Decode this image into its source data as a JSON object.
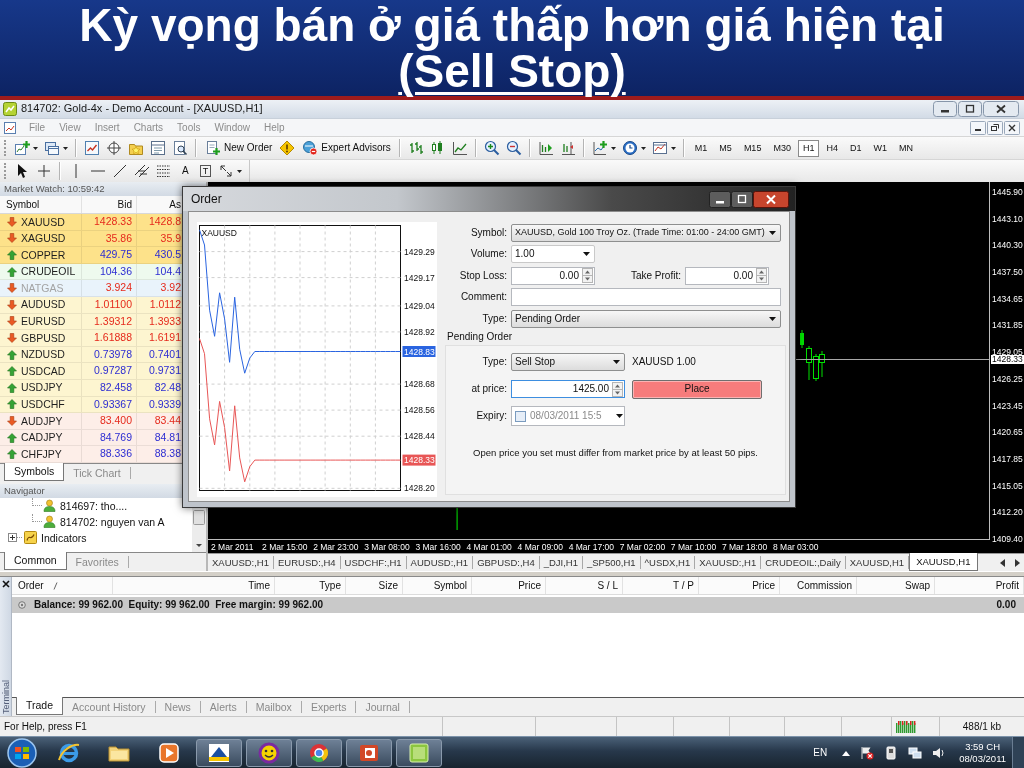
{
  "slide": {
    "title": "Kỳ vọng bán ở giá thấp hơn giá hiện tại",
    "subtitle": "(Sell Stop)"
  },
  "window": {
    "title": "814702: Gold-4x - Demo Account - [XAUUSD,H1]"
  },
  "menu": [
    {
      "label": "File",
      "disabled": true
    },
    {
      "label": "View",
      "disabled": true
    },
    {
      "label": "Insert",
      "disabled": true
    },
    {
      "label": "Charts",
      "disabled": true
    },
    {
      "label": "Tools",
      "disabled": true
    },
    {
      "label": "Window",
      "disabled": true
    },
    {
      "label": "Help",
      "disabled": true
    }
  ],
  "toolbar": {
    "new_order": "New Order",
    "expert_advisors": "Expert Advisors",
    "timeframes": [
      {
        "label": "M1",
        "selected": false
      },
      {
        "label": "M5",
        "selected": false
      },
      {
        "label": "M15",
        "selected": false
      },
      {
        "label": "M30",
        "selected": false
      },
      {
        "label": "H1",
        "selected": true
      },
      {
        "label": "H4",
        "selected": false
      },
      {
        "label": "D1",
        "selected": false
      },
      {
        "label": "W1",
        "selected": false
      },
      {
        "label": "MN",
        "selected": false
      }
    ]
  },
  "drawing_toolbar": {
    "text_tool": "A",
    "label_tool": "T"
  },
  "market_watch": {
    "title": "Market Watch: 10:59:42",
    "columns": [
      "Symbol",
      "Bid",
      "As"
    ],
    "rows": [
      {
        "symbol": "XAUUSD",
        "bid": "1428.33",
        "ask": "1428.8",
        "rising": false,
        "color": "#fde28a",
        "disabled": false
      },
      {
        "symbol": "XAGUSD",
        "bid": "35.86",
        "ask": "35.9",
        "rising": false,
        "color": "#fde28a",
        "disabled": false
      },
      {
        "symbol": "COPPER",
        "bid": "429.75",
        "ask": "430.5",
        "rising": true,
        "color": "#fde28a",
        "disabled": false
      },
      {
        "symbol": "CRUDEOIL",
        "bid": "104.36",
        "ask": "104.4",
        "rising": true,
        "color": "#eefaee",
        "disabled": false
      },
      {
        "symbol": "NATGAS",
        "bid": "3.924",
        "ask": "3.92",
        "rising": false,
        "color": "#e9f3fb",
        "disabled": true
      },
      {
        "symbol": "AUDUSD",
        "bid": "1.01100",
        "ask": "1.0112",
        "rising": false,
        "color": "#fdf5d0",
        "disabled": false
      },
      {
        "symbol": "EURUSD",
        "bid": "1.39312",
        "ask": "1.3933",
        "rising": false,
        "color": "#fdf5d0",
        "disabled": false
      },
      {
        "symbol": "GBPUSD",
        "bid": "1.61888",
        "ask": "1.6191",
        "rising": false,
        "color": "#fdf5d0",
        "disabled": false
      },
      {
        "symbol": "NZDUSD",
        "bid": "0.73978",
        "ask": "0.7401",
        "rising": true,
        "color": "#fdf5d0",
        "disabled": false
      },
      {
        "symbol": "USDCAD",
        "bid": "0.97287",
        "ask": "0.9731",
        "rising": true,
        "color": "#fdf5d0",
        "disabled": false
      },
      {
        "symbol": "USDJPY",
        "bid": "82.458",
        "ask": "82.48",
        "rising": true,
        "color": "#fdf5d0",
        "disabled": false
      },
      {
        "symbol": "USDCHF",
        "bid": "0.93367",
        "ask": "0.9339",
        "rising": true,
        "color": "#fdf5d0",
        "disabled": false
      },
      {
        "symbol": "AUDJPY",
        "bid": "83.400",
        "ask": "83.44",
        "rising": false,
        "color": "#fdeee8",
        "disabled": false
      },
      {
        "symbol": "CADJPY",
        "bid": "84.769",
        "ask": "84.81",
        "rising": true,
        "color": "#fdeee8",
        "disabled": false
      },
      {
        "symbol": "CHFJPY",
        "bid": "88.336",
        "ask": "88.38",
        "rising": true,
        "color": "#fdeee8",
        "disabled": false
      }
    ],
    "tabs": [
      {
        "label": "Symbols",
        "selected": true
      },
      {
        "label": "Tick Chart",
        "selected": false
      }
    ]
  },
  "navigator": {
    "title": "Navigator",
    "tree": [
      {
        "kind": "group",
        "children": [
          {
            "kind": "account",
            "label": "814697: tho...."
          },
          {
            "kind": "account",
            "label": "814702: nguyen van A"
          }
        ]
      },
      {
        "kind": "folder",
        "label": "Indicators",
        "expanded": false
      }
    ],
    "tabs": [
      {
        "label": "Common",
        "selected": true
      },
      {
        "label": "Favorites",
        "selected": false
      }
    ]
  },
  "chart": {
    "price_axis": [
      {
        "kind": "tick",
        "label": "1445.90"
      },
      {
        "kind": "tick",
        "label": "1443.10"
      },
      {
        "kind": "tick",
        "label": "1440.30"
      },
      {
        "kind": "tick",
        "label": "1437.50"
      },
      {
        "kind": "tick",
        "label": "1434.65"
      },
      {
        "kind": "tick",
        "label": "1431.85"
      },
      {
        "kind": "tick",
        "label": "1429.05"
      },
      {
        "kind": "current",
        "label": "1428.33"
      },
      {
        "kind": "tick",
        "label": "1426.25"
      },
      {
        "kind": "tick",
        "label": "1423.45"
      },
      {
        "kind": "tick",
        "label": "1420.65"
      },
      {
        "kind": "tick",
        "label": "1417.85"
      },
      {
        "kind": "tick",
        "label": "1415.05"
      },
      {
        "kind": "tick",
        "label": "1412.20"
      },
      {
        "kind": "tick",
        "label": "1409.40"
      }
    ],
    "time_axis": [
      "2 Mar 2011",
      "2 Mar 15:00",
      "2 Mar 23:00",
      "3 Mar 08:00",
      "3 Mar 16:00",
      "4 Mar 01:00",
      "4 Mar 09:00",
      "4 Mar 17:00",
      "7 Mar 02:00",
      "7 Mar 10:00",
      "7 Mar 18:00",
      "8 Mar 03:00"
    ],
    "tabs": [
      {
        "label": "XAUUSD:,H1",
        "selected": false
      },
      {
        "label": "EURUSD:,H4",
        "selected": false
      },
      {
        "label": "USDCHF:,H1",
        "selected": false
      },
      {
        "label": "AUDUSD:,H1",
        "selected": false
      },
      {
        "label": "GBPUSD:,H4",
        "selected": false
      },
      {
        "label": "_DJI,H1",
        "selected": false
      },
      {
        "label": "_SP500,H1",
        "selected": false
      },
      {
        "label": "^USDX,H1",
        "selected": false
      },
      {
        "label": "XAUUSD:,H1",
        "selected": false
      },
      {
        "label": "CRUDEOIL:,Daily",
        "selected": false
      },
      {
        "label": "XAUUSD,H1",
        "selected": false
      },
      {
        "label": "XAUUSD,H1",
        "selected": true
      }
    ]
  },
  "order_dialog": {
    "title": "Order",
    "chart_data": {
      "type": "line",
      "title": "XAUUSD",
      "grid": true,
      "categories": [
        null,
        null,
        null,
        null,
        null,
        null,
        null,
        null,
        null,
        null,
        null,
        null,
        null,
        null,
        null,
        null,
        null,
        null,
        null,
        null,
        null,
        null,
        null,
        null,
        null,
        null,
        null,
        null,
        null,
        null,
        null,
        null,
        null,
        null,
        null,
        null,
        null,
        null,
        null,
        null,
        null
      ],
      "ylim": [
        1428.19,
        1429.41
      ],
      "yticks": [
        {
          "value": 1429.29,
          "label": "1429.29"
        },
        {
          "value": 1429.17,
          "label": "1429.17"
        },
        {
          "value": 1429.04,
          "label": "1429.04"
        },
        {
          "value": 1428.92,
          "label": "1428.92"
        },
        {
          "value": 1428.68,
          "label": "1428.68"
        },
        {
          "value": 1428.56,
          "label": "1428.56"
        },
        {
          "value": 1428.44,
          "label": "1428.44"
        },
        {
          "value": 1428.2,
          "label": "1428.20"
        }
      ],
      "series": [
        {
          "color": "#2a64e0",
          "values": [
            1429.39,
            1429.32,
            1429.02,
            1428.9,
            1429.1,
            1428.98,
            1428.78,
            1429.08,
            1428.84,
            1428.73,
            1428.8,
            1428.83,
            1428.83,
            1428.83,
            1428.83,
            1428.83,
            1428.83,
            1428.83,
            1428.83,
            1428.83,
            1428.83,
            1428.83,
            1428.83,
            1428.83,
            1428.83,
            1428.83,
            1428.83,
            1428.83,
            1428.83,
            1428.83,
            1428.83,
            1428.83,
            1428.83,
            1428.83,
            1428.83,
            1428.83,
            1428.83,
            1428.83,
            1428.83,
            1428.83,
            1428.83
          ]
        },
        {
          "color": "#e85656",
          "values": [
            1428.89,
            1428.82,
            1428.52,
            1428.4,
            1428.6,
            1428.48,
            1428.28,
            1428.58,
            1428.34,
            1428.23,
            1428.3,
            1428.33,
            1428.33,
            1428.33,
            1428.33,
            1428.33,
            1428.33,
            1428.33,
            1428.33,
            1428.33,
            1428.33,
            1428.33,
            1428.33,
            1428.33,
            1428.33,
            1428.33,
            1428.33,
            1428.33,
            1428.33,
            1428.33,
            1428.33,
            1428.33,
            1428.33,
            1428.33,
            1428.33,
            1428.33,
            1428.33,
            1428.33,
            1428.33,
            1428.33,
            1428.33
          ]
        }
      ]
    },
    "price_tags": [
      "1428.83",
      "1428.33"
    ],
    "symbol": {
      "label": "Symbol:",
      "value": "XAUUSD, Gold 100 Troy Oz. (Trade Time: 01:00 - 24:00 GMT)"
    },
    "volume": {
      "label": "Volume:",
      "value": "1.00"
    },
    "stop_loss": {
      "label": "Stop Loss:",
      "value": "0.00"
    },
    "take_profit": {
      "label": "Take Profit:",
      "value": "0.00"
    },
    "comment": {
      "label": "Comment:"
    },
    "type": {
      "label": "Type:",
      "value": "Pending Order"
    },
    "pending": {
      "title": "Pending Order",
      "type": {
        "label": "Type:",
        "value": "Sell Stop"
      },
      "summary": "XAUUSD 1.00",
      "price": {
        "label": "at price:",
        "value": "1425.00",
        "focused": true
      },
      "place": "Place",
      "expiry": {
        "label": "Expiry:",
        "checked": false,
        "value": "08/03/2011 15:5"
      }
    },
    "note": "Open price you set must differ from market price by at least 50 pips."
  },
  "terminal": {
    "title": "Terminal",
    "columns": [
      "Order",
      "Time",
      "Type",
      "Size",
      "Symbol",
      "Price",
      "S / L",
      "T / P",
      "Price",
      "Commission",
      "Swap",
      "Profit"
    ],
    "summary": "Balance: 99 962.00  Equity: 99 962.00  Free margin: 99 962.00",
    "profit": "0.00",
    "tabs": [
      {
        "label": "Trade",
        "selected": true
      },
      {
        "label": "Account History",
        "selected": false
      },
      {
        "label": "News",
        "selected": false
      },
      {
        "label": "Alerts",
        "selected": false
      },
      {
        "label": "Mailbox",
        "selected": false
      },
      {
        "label": "Experts",
        "selected": false
      },
      {
        "label": "Journal",
        "selected": false
      }
    ]
  },
  "status_bar": {
    "help": "For Help, press F1",
    "traffic": "488/1 kb"
  },
  "taskbar": {
    "language": "EN",
    "time": "3:59 CH",
    "date": "08/03/2011"
  }
}
